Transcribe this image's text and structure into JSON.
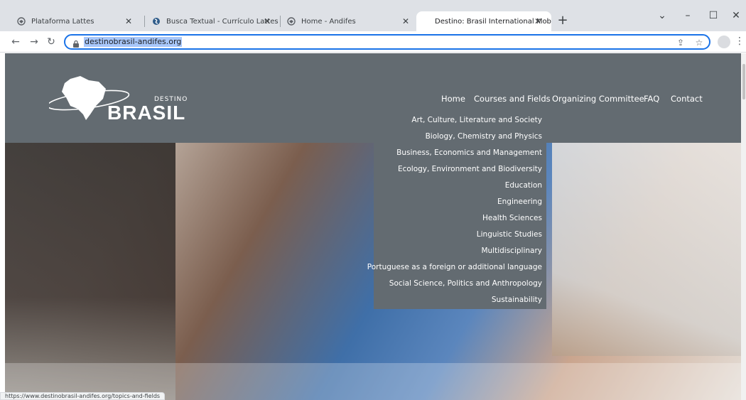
{
  "browser": {
    "tabs": [
      {
        "title": "Plataforma Lattes",
        "active": false
      },
      {
        "title": "Busca Textual - Currículo Lattes",
        "active": false
      },
      {
        "title": "Home - Andifes",
        "active": false
      },
      {
        "title": "Destino: Brasil International Mob",
        "active": true
      }
    ],
    "new_tab_label": "+",
    "address_url": "destinobrasil-andifes.org",
    "status_url": "https://www.destinobrasil-andifes.org/topics-and-fields",
    "accent_color": "#1a73e8"
  },
  "site": {
    "brand_small": "DESTINO",
    "brand_big": "BRASIL",
    "header_color": "#636b71",
    "nav": [
      "Home",
      "Courses and Fields",
      "Organizing Committee",
      "FAQ",
      "Contact"
    ],
    "dropdown": [
      "Art, Culture, Literature and Society",
      "Biology, Chemistry and Physics",
      "Business, Economics and Management",
      "Ecology, Environment and Biodiversity",
      "Education",
      "Engineering",
      "Health Sciences",
      "Linguistic Studies",
      "Multidisciplinary",
      "Portuguese as a foreign or additional language",
      "Social Science, Politics and Anthropology",
      "Sustainability"
    ]
  }
}
